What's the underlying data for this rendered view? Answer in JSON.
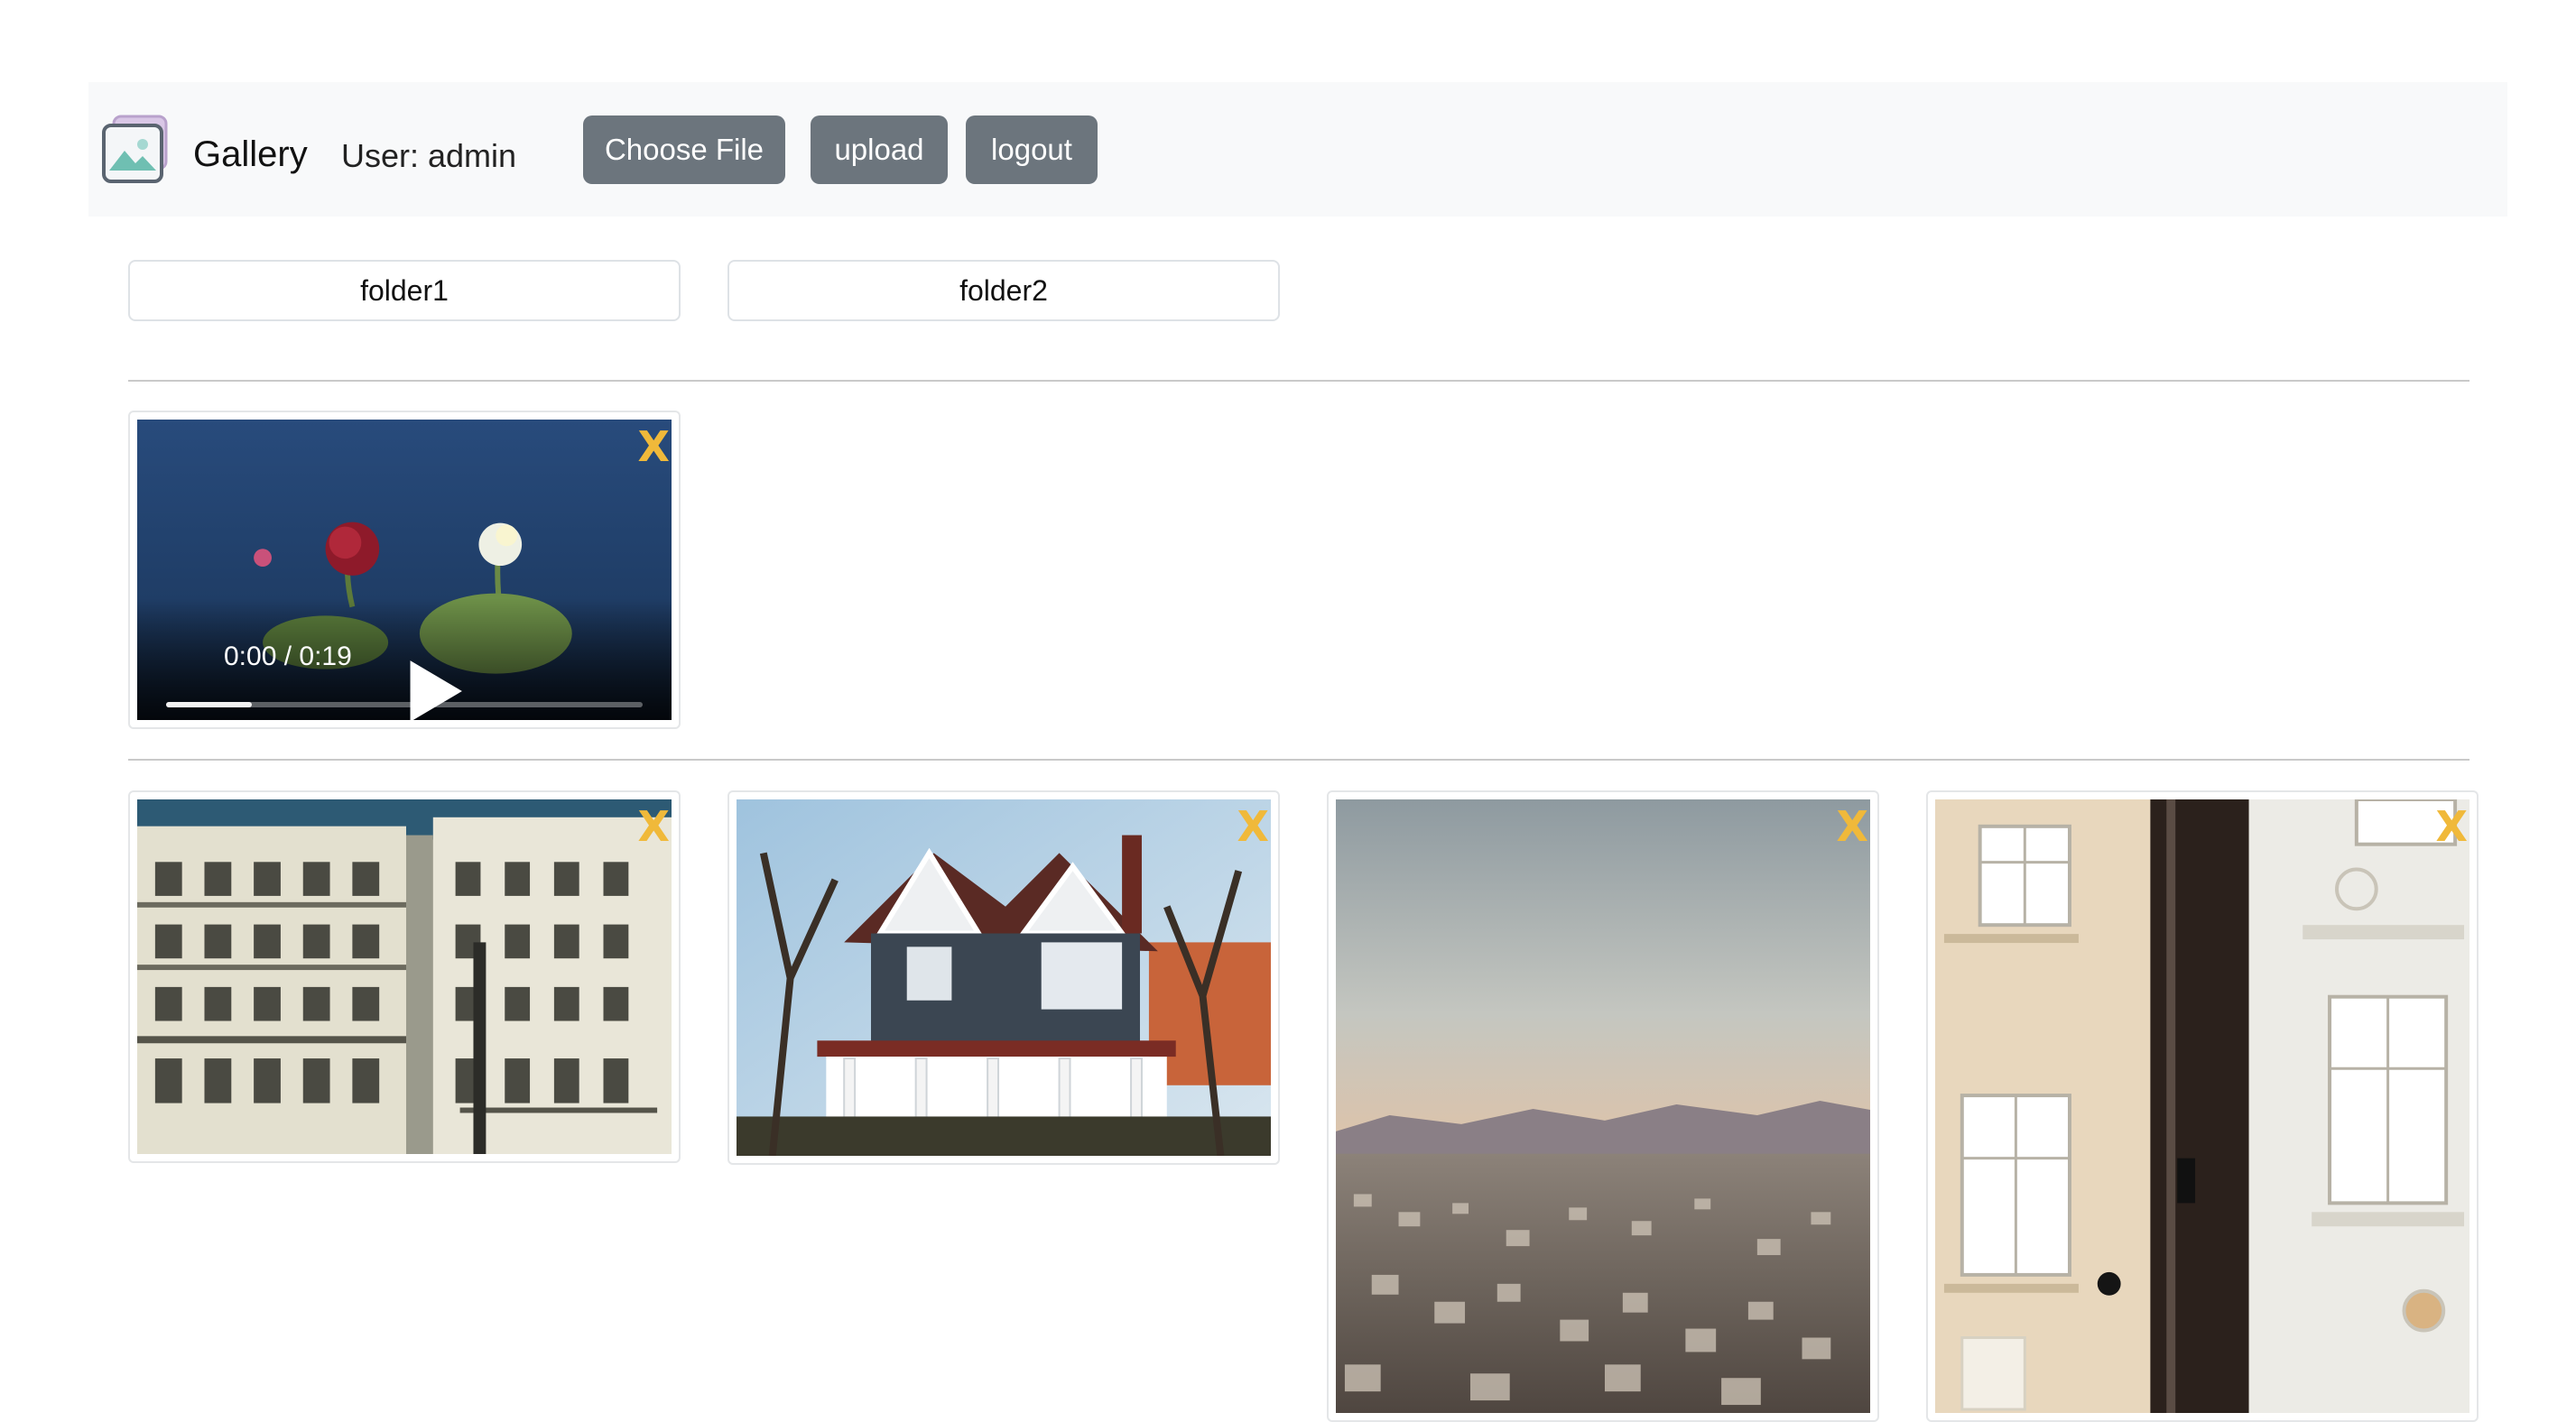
{
  "navbar": {
    "logo_icon": "image-icon",
    "brand": "Gallery",
    "user_text": "User: admin",
    "choose_file_label": "Choose File",
    "upload_label": "upload",
    "logout_label": "logout"
  },
  "folders": [
    "folder1",
    "folder2"
  ],
  "video": {
    "time": "0:00 / 0:19",
    "progress_fraction": 0.18,
    "close_label": "X"
  },
  "images": [
    {
      "subject": "parisian-apartment-building",
      "close_label": "X"
    },
    {
      "subject": "victorian-house",
      "close_label": "X"
    },
    {
      "subject": "city-skyline",
      "close_label": "X"
    },
    {
      "subject": "building-facade",
      "close_label": "X"
    }
  ],
  "colors": {
    "navbar_bg": "#f8f9fa",
    "button_bg": "#6c757d",
    "close_x": "#f0b93a"
  }
}
